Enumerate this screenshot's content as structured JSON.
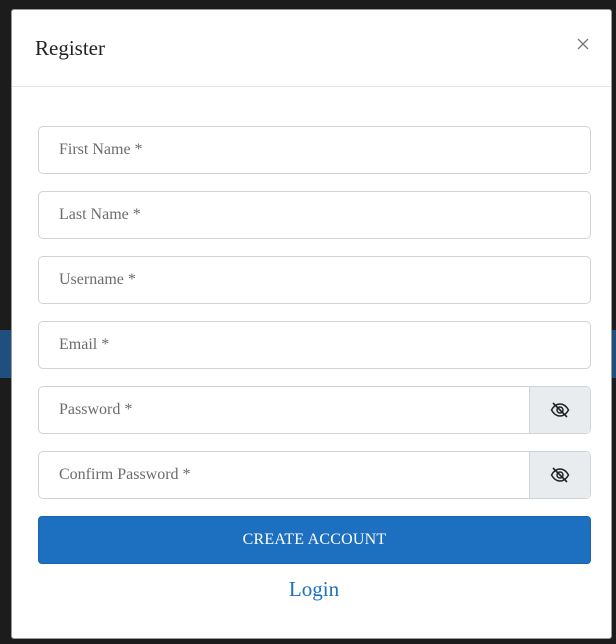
{
  "modal": {
    "title": "Register",
    "close_label": "×"
  },
  "form": {
    "fields": {
      "first_name": {
        "placeholder": "First Name *",
        "value": ""
      },
      "last_name": {
        "placeholder": "Last Name *",
        "value": ""
      },
      "username": {
        "placeholder": "Username *",
        "value": ""
      },
      "email": {
        "placeholder": "Email *",
        "value": ""
      },
      "password": {
        "placeholder": "Password *",
        "value": "",
        "toggle_icon": "eye-slash-icon"
      },
      "confirm_password": {
        "placeholder": "Confirm Password *",
        "value": "",
        "toggle_icon": "eye-slash-icon"
      }
    },
    "submit_label": "CREATE ACCOUNT",
    "login_link": "Login"
  },
  "colors": {
    "primary": "#1d70bf",
    "link": "#1d6fc0",
    "addon_bg": "#e9ecef",
    "border": "#cfd4d9"
  }
}
